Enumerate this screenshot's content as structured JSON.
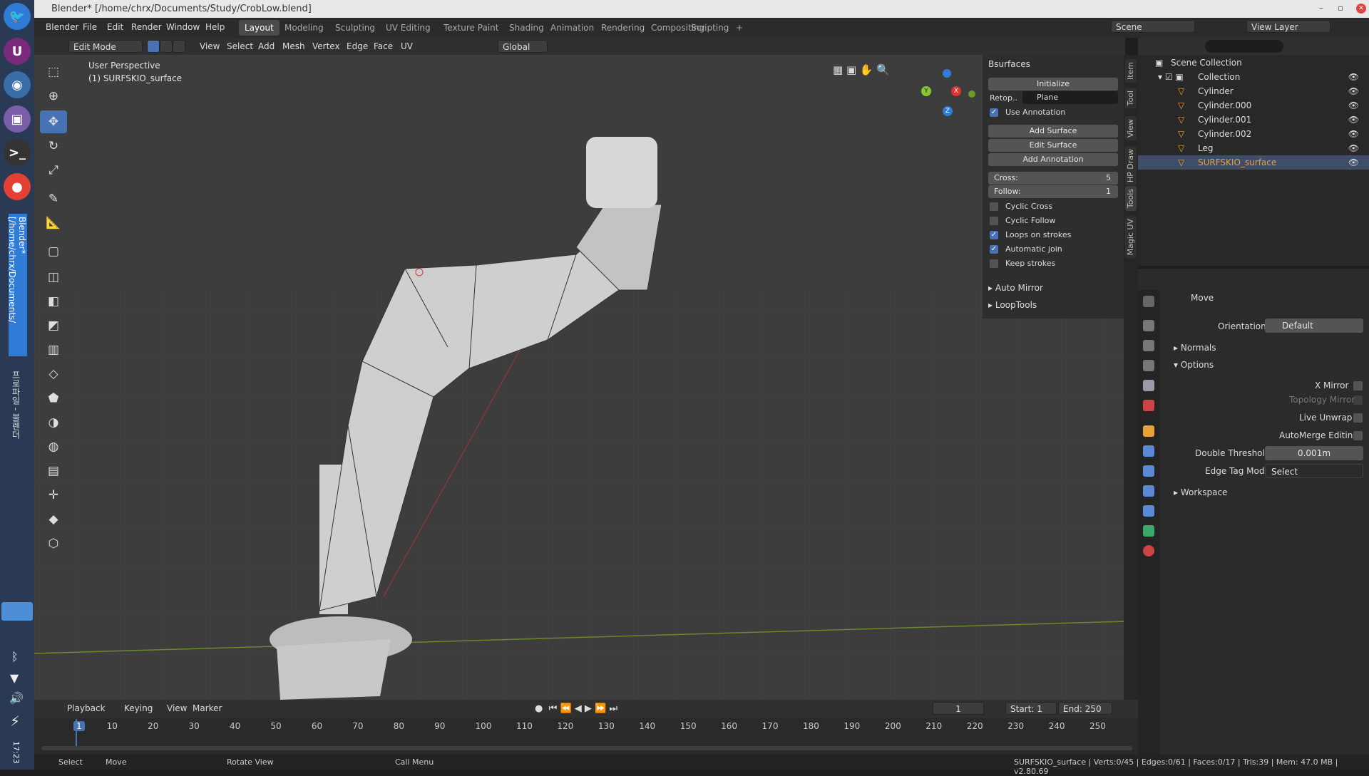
{
  "window": {
    "title": "Blender* [/home/chrx/Documents/Study/CrobLow.blend]",
    "controls": [
      "–",
      "▫",
      "✕"
    ]
  },
  "dock": {
    "vertical_title": "Blender* [/home/chrx/Documents/",
    "vertical_text2": "프로파일 - 블렌더",
    "clock": "17:23"
  },
  "menu": [
    "Blender",
    "File",
    "Edit",
    "Render",
    "Window",
    "Help"
  ],
  "workspaces": [
    {
      "label": "Layout",
      "active": true
    },
    {
      "label": "Modeling"
    },
    {
      "label": "Sculpting"
    },
    {
      "label": "UV Editing"
    },
    {
      "label": "Texture Paint"
    },
    {
      "label": "Shading"
    },
    {
      "label": "Animation"
    },
    {
      "label": "Rendering"
    },
    {
      "label": "Compositing"
    },
    {
      "label": "Scripting"
    },
    {
      "label": "+"
    }
  ],
  "scene": {
    "label": "Scene",
    "view_layer": "View Layer"
  },
  "header": {
    "mode": "Edit Mode",
    "menus": [
      "View",
      "Select",
      "Add",
      "Mesh",
      "Vertex",
      "Edge",
      "Face",
      "UV"
    ],
    "transform": "Global"
  },
  "viewport": {
    "perspective": "User Perspective",
    "object": "(1) SURFSKIO_surface",
    "gizmo": {
      "x": "X",
      "y": "Y",
      "z": "Z"
    }
  },
  "npanel": {
    "title": "Bsurfaces",
    "initialize": "Initialize",
    "retopo_label": "Retop..",
    "retopo_value": "Plane",
    "use_annotation": "Use Annotation",
    "add_surface": "Add Surface",
    "edit_surface": "Edit Surface",
    "add_annotation": "Add Annotation",
    "cross_label": "Cross:",
    "cross_value": "5",
    "follow_label": "Follow:",
    "follow_value": "1",
    "checks": [
      {
        "label": "Cyclic Cross",
        "on": false
      },
      {
        "label": "Cyclic Follow",
        "on": false
      },
      {
        "label": "Loops on strokes",
        "on": true
      },
      {
        "label": "Automatic join",
        "on": true
      },
      {
        "label": "Keep strokes",
        "on": false
      }
    ],
    "auto_mirror": "Auto Mirror",
    "looptools": "LoopTools",
    "tabs": [
      "Item",
      "Tool",
      "View",
      "HP Draw",
      "Tools",
      "Magic UV"
    ]
  },
  "outliner": {
    "scene_collection": "Scene Collection",
    "collection": "Collection",
    "items": [
      "Cylinder",
      "Cylinder.000",
      "Cylinder.001",
      "Cylinder.002",
      "Leg",
      "SURFSKIO_surface"
    ]
  },
  "properties": {
    "tool": "Move",
    "orientation_label": "Orientation",
    "orientation_value": "Default",
    "normals": "Normals",
    "options": "Options",
    "x_mirror": "X Mirror",
    "topology_mirror": "Topology Mirror",
    "live_unwrap": "Live Unwrap",
    "automerge": "AutoMerge Editing",
    "double_threshold_label": "Double Threshold",
    "double_threshold_value": "0.001m",
    "edge_tag_label": "Edge Tag Mode",
    "edge_tag_value": "Select",
    "workspace": "Workspace"
  },
  "timeline": {
    "menus": [
      "Playback",
      "Keying",
      "View",
      "Marker"
    ],
    "current": "1",
    "start_label": "Start:",
    "start": "1",
    "end_label": "End:",
    "end": "250",
    "ticks": [
      "1",
      "10",
      "20",
      "30",
      "40",
      "50",
      "60",
      "70",
      "80",
      "90",
      "100",
      "110",
      "120",
      "130",
      "140",
      "150",
      "160",
      "170",
      "180",
      "190",
      "200",
      "210",
      "220",
      "230",
      "240",
      "250"
    ]
  },
  "status": {
    "select": "Select",
    "move": "Move",
    "rotate": "Rotate View",
    "call_menu": "Call Menu",
    "stats": "SURFSKIO_surface | Verts:0/45 | Edges:0/61 | Faces:0/17 | Tris:39 | Mem: 47.0 MB | v2.80.69"
  },
  "colors": {
    "accent": "#4772b3",
    "selected_obj": "#e7a13a",
    "bg": "#3d3d3d"
  }
}
